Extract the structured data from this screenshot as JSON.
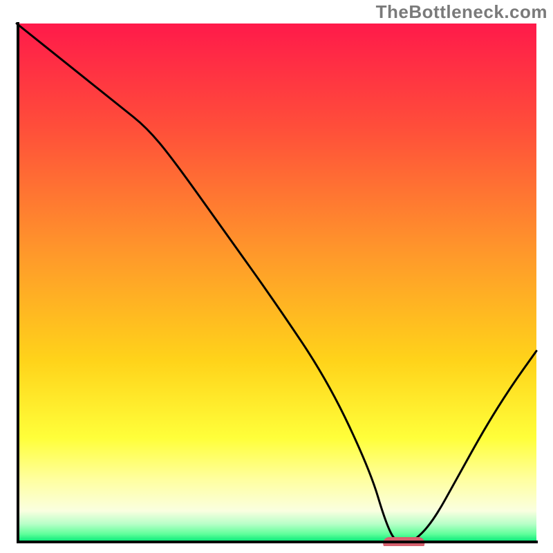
{
  "watermark": "TheBottleneck.com",
  "chart_data": {
    "type": "line",
    "title": "",
    "xlabel": "",
    "ylabel": "",
    "xlim": [
      0,
      100
    ],
    "ylim": [
      0,
      100
    ],
    "grid": false,
    "legend": false,
    "gradient_stops": [
      {
        "offset": 0.0,
        "color": "#ff1a4a"
      },
      {
        "offset": 0.2,
        "color": "#ff4e3a"
      },
      {
        "offset": 0.45,
        "color": "#ff9a2a"
      },
      {
        "offset": 0.65,
        "color": "#ffd31a"
      },
      {
        "offset": 0.8,
        "color": "#ffff3a"
      },
      {
        "offset": 0.88,
        "color": "#ffffa0"
      },
      {
        "offset": 0.94,
        "color": "#faffe0"
      },
      {
        "offset": 0.965,
        "color": "#b8ffc8"
      },
      {
        "offset": 0.985,
        "color": "#5eff9a"
      },
      {
        "offset": 1.0,
        "color": "#00e676"
      }
    ],
    "x": [
      0,
      10,
      20,
      25,
      30,
      40,
      50,
      60,
      68,
      71,
      73,
      76,
      80,
      85,
      90,
      95,
      100
    ],
    "y": [
      100,
      92,
      84,
      80,
      74,
      60,
      46,
      31,
      14,
      4,
      0,
      0,
      4,
      13,
      22,
      30,
      37
    ],
    "marker": {
      "x": 74.5,
      "y": 0,
      "rx": 4.0,
      "ry": 1.2,
      "color": "#d6606e"
    },
    "axis_color": "#000000",
    "axis_width": 4,
    "line_color": "#000000",
    "line_width": 3
  }
}
